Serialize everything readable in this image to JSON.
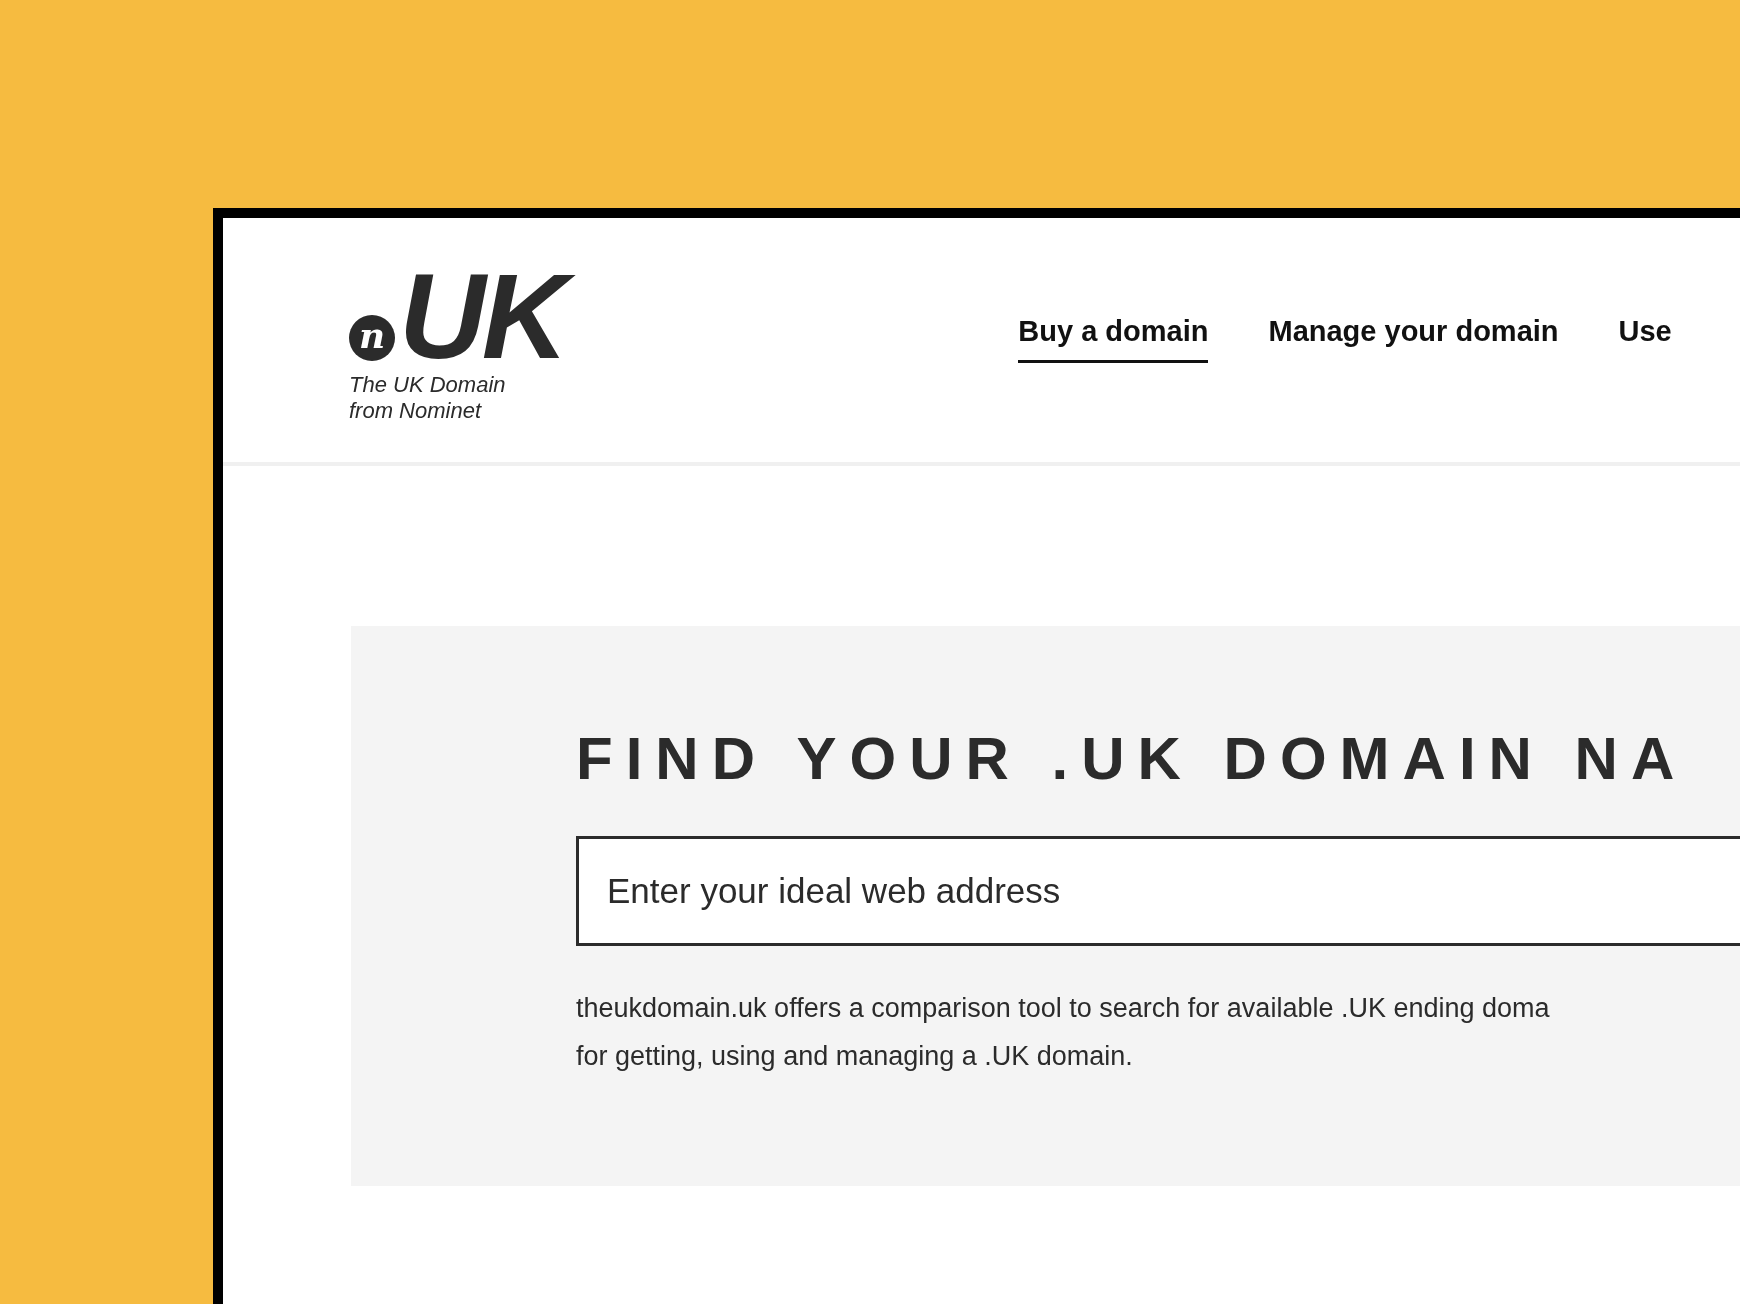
{
  "logo": {
    "mark": "n",
    "wordmark": "UK",
    "tagline": [
      "The UK Domain",
      "from Nominet"
    ]
  },
  "nav": [
    {
      "label": "Buy a domain",
      "selected": true
    },
    {
      "label": "Manage your domain",
      "selected": false
    },
    {
      "label": "Use",
      "selected": false
    }
  ],
  "search_panel": {
    "heading": "FIND YOUR .UK DOMAIN NA",
    "search": {
      "placeholder": "Enter your ideal web address"
    },
    "description": [
      "theukdomain.uk offers a comparison tool to search for available .UK ending doma",
      "for getting, using and managing a .UK domain."
    ]
  }
}
